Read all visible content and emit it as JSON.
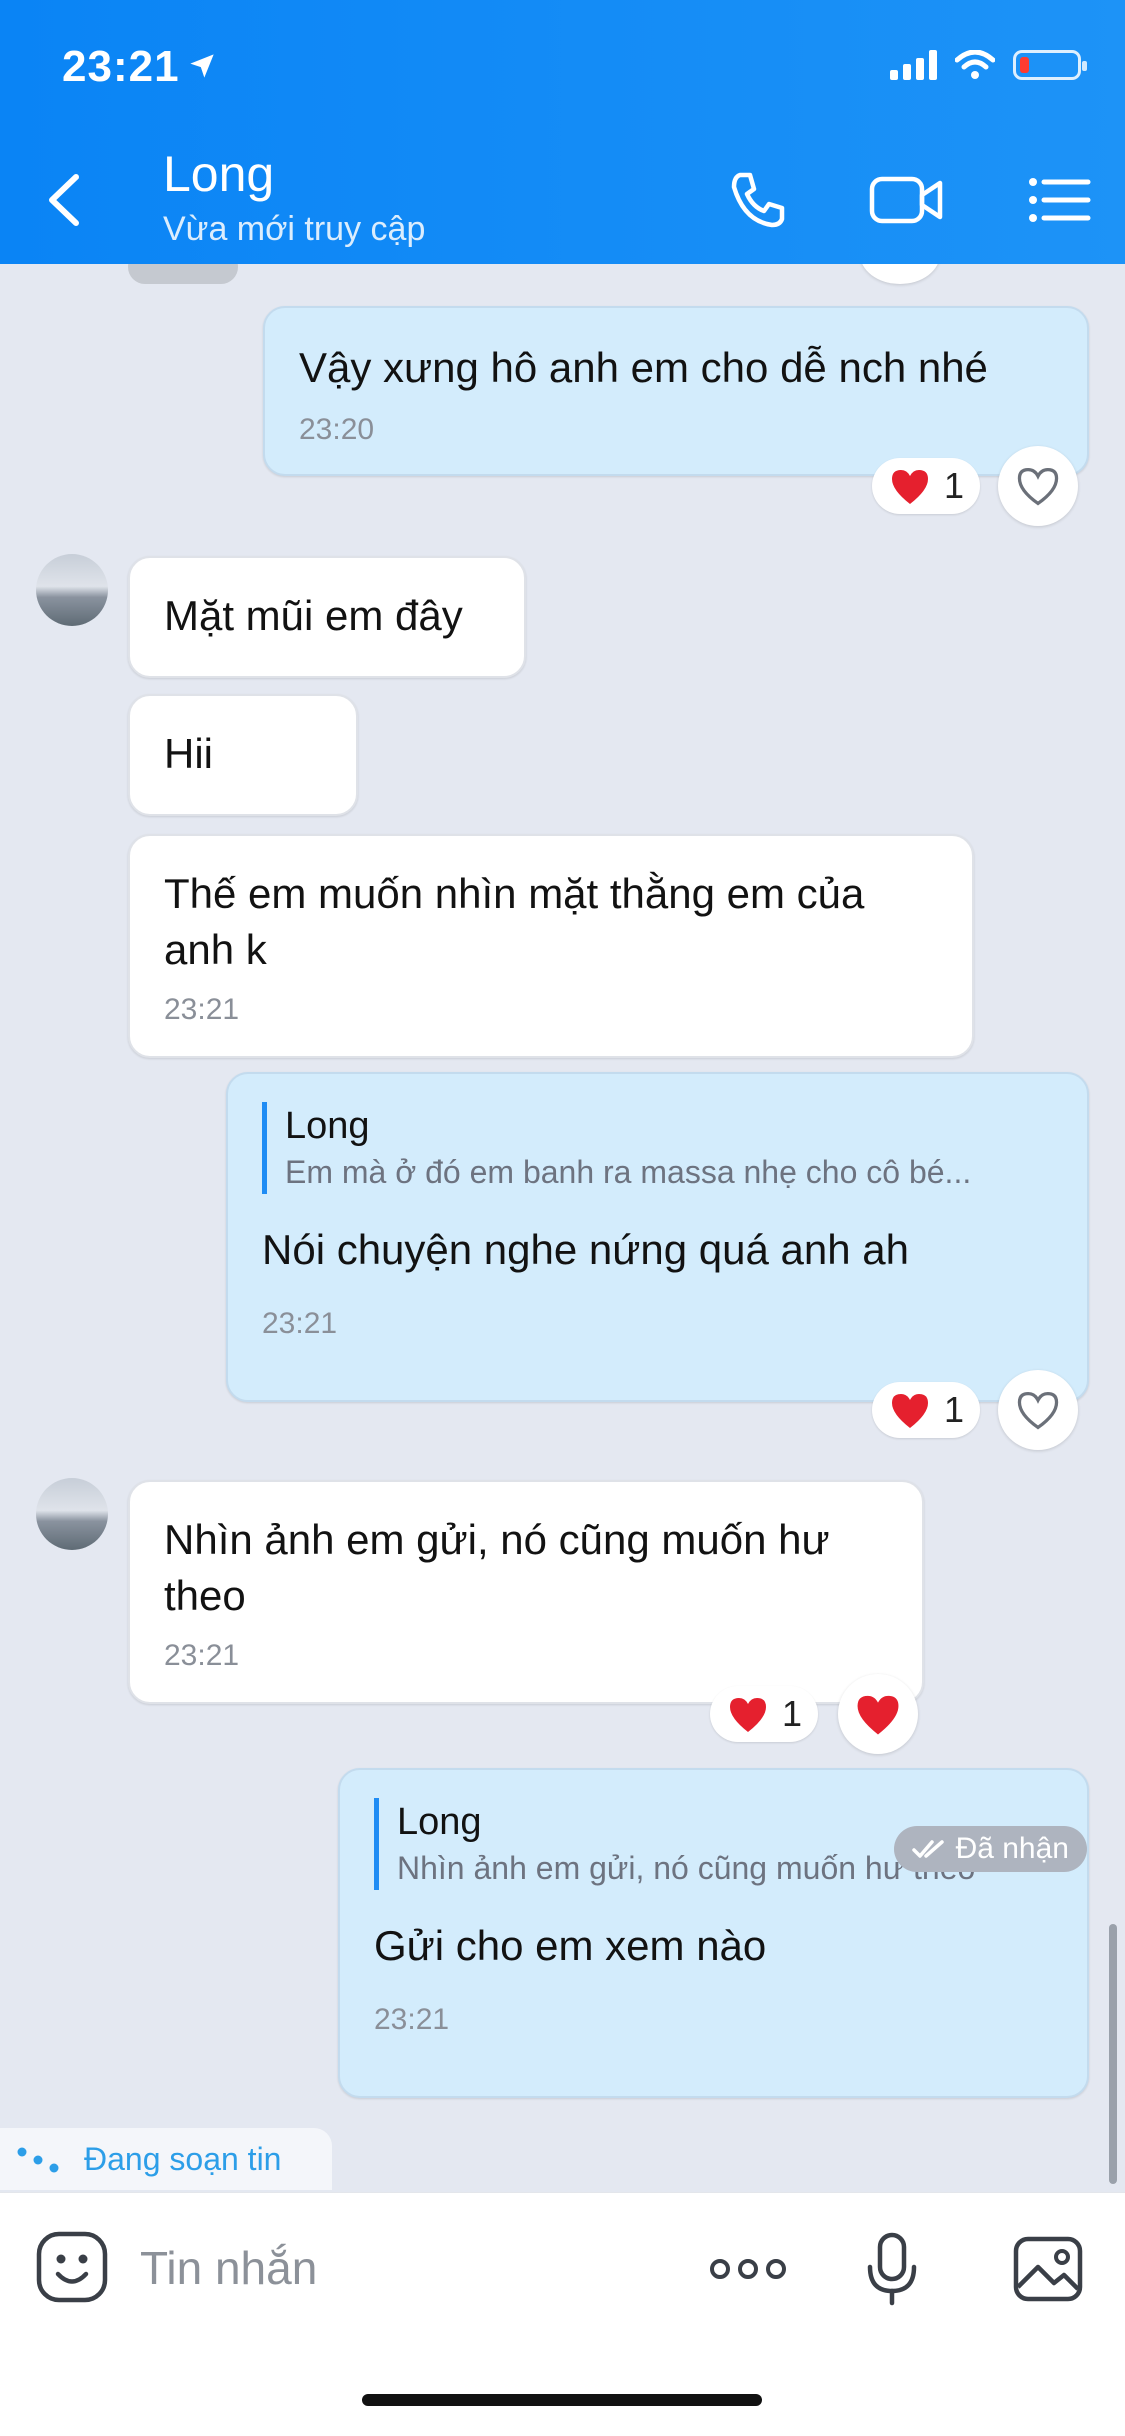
{
  "status_bar": {
    "time": "23:21"
  },
  "header": {
    "contact_name": "Long",
    "contact_status": "Vừa mới truy cập",
    "icons": {
      "back": "chevron-left-icon",
      "call": "phone-icon",
      "video": "video-camera-icon",
      "menu": "list-menu-icon"
    }
  },
  "messages": [
    {
      "direction": "out",
      "text": "Vậy xưng hô anh em cho dễ nch nhé",
      "time": "23:20",
      "reaction_count": "1"
    },
    {
      "direction": "in",
      "text": "Mặt mũi em đây"
    },
    {
      "direction": "in",
      "text": "Hii"
    },
    {
      "direction": "in",
      "text": "Thế em muốn nhìn mặt thằng em của anh k",
      "time": "23:21"
    },
    {
      "direction": "out",
      "quote_name": "Long",
      "quote_text": "Em mà ở đó em banh ra massa nhẹ cho cô bé...",
      "text": "Nói chuyện nghe nứng quá anh ah",
      "time": "23:21",
      "reaction_count": "1"
    },
    {
      "direction": "in",
      "text": "Nhìn ảnh em gửi, nó cũng muốn hư theo",
      "time": "23:21",
      "reaction_count": "1"
    },
    {
      "direction": "out",
      "quote_name": "Long",
      "quote_text": "Nhìn ảnh em gửi, nó cũng muốn hư theo",
      "text": "Gửi cho em xem nào",
      "time": "23:21"
    }
  ],
  "delivery_status": "Đã nhận",
  "typing_indicator": "Đang soạn tin",
  "composer": {
    "placeholder": "Tin nhắn"
  },
  "colors": {
    "header": "#0a84f5",
    "outgoing_bubble": "#d3ecfc",
    "incoming_bubble": "#ffffff",
    "chat_background": "#e4e8f1",
    "heart": "#e5202e"
  }
}
